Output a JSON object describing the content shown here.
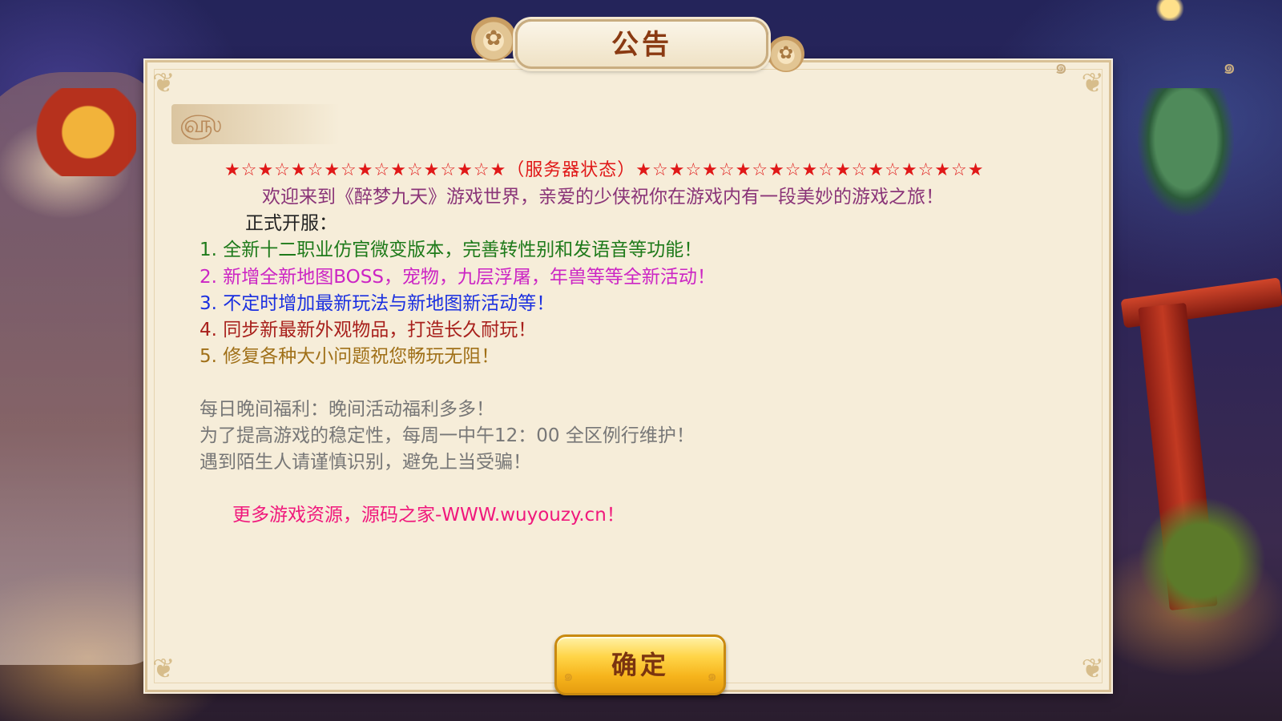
{
  "dialog": {
    "title": "公告",
    "stars_line": "★☆★☆★☆★☆★☆★☆★☆★☆★（服务器状态）★☆★☆★☆★☆★☆★☆★☆★☆★☆★☆★",
    "welcome": "欢迎来到《醉梦九天》游戏世界，亲爱的少侠祝你在游戏内有一段美妙的游戏之旅！",
    "launch_heading": "正式开服：",
    "items": [
      "1. 全新十二职业仿官微变版本，完善转性别和发语音等功能！",
      "2. 新增全新地图BOSS，宠物，九层浮屠，年兽等等全新活动！",
      "3. 不定时增加最新玩法与新地图新活动等！",
      "4. 同步新最新外观物品，打造长久耐玩！",
      "5. 修复各种大小问题祝您畅玩无阻！"
    ],
    "notices": [
      "每日晚间福利：晚间活动福利多多！",
      "为了提高游戏的稳定性，每周一中午12：00 全区例行维护！",
      "遇到陌生人请谨慎识别，避免上当受骗！"
    ],
    "promo": "更多游戏资源，源码之家-WWW.wuyouzy.cn！",
    "confirm_label": "确定"
  },
  "colors": {
    "stars": "#e01818",
    "welcome": "#8a3478",
    "item_1": "#1e7a1a",
    "item_2": "#cc25c4",
    "item_3": "#1a2fe0",
    "item_4": "#a8201c",
    "item_5": "#a07018",
    "notice": "#777777",
    "promo": "#f0187c",
    "panel": "#f6edd9",
    "button": "#f6b41c"
  },
  "icons": [
    "lotus-ornament-icon",
    "cloud-swirl-icon",
    "corner-ornament-icon"
  ]
}
